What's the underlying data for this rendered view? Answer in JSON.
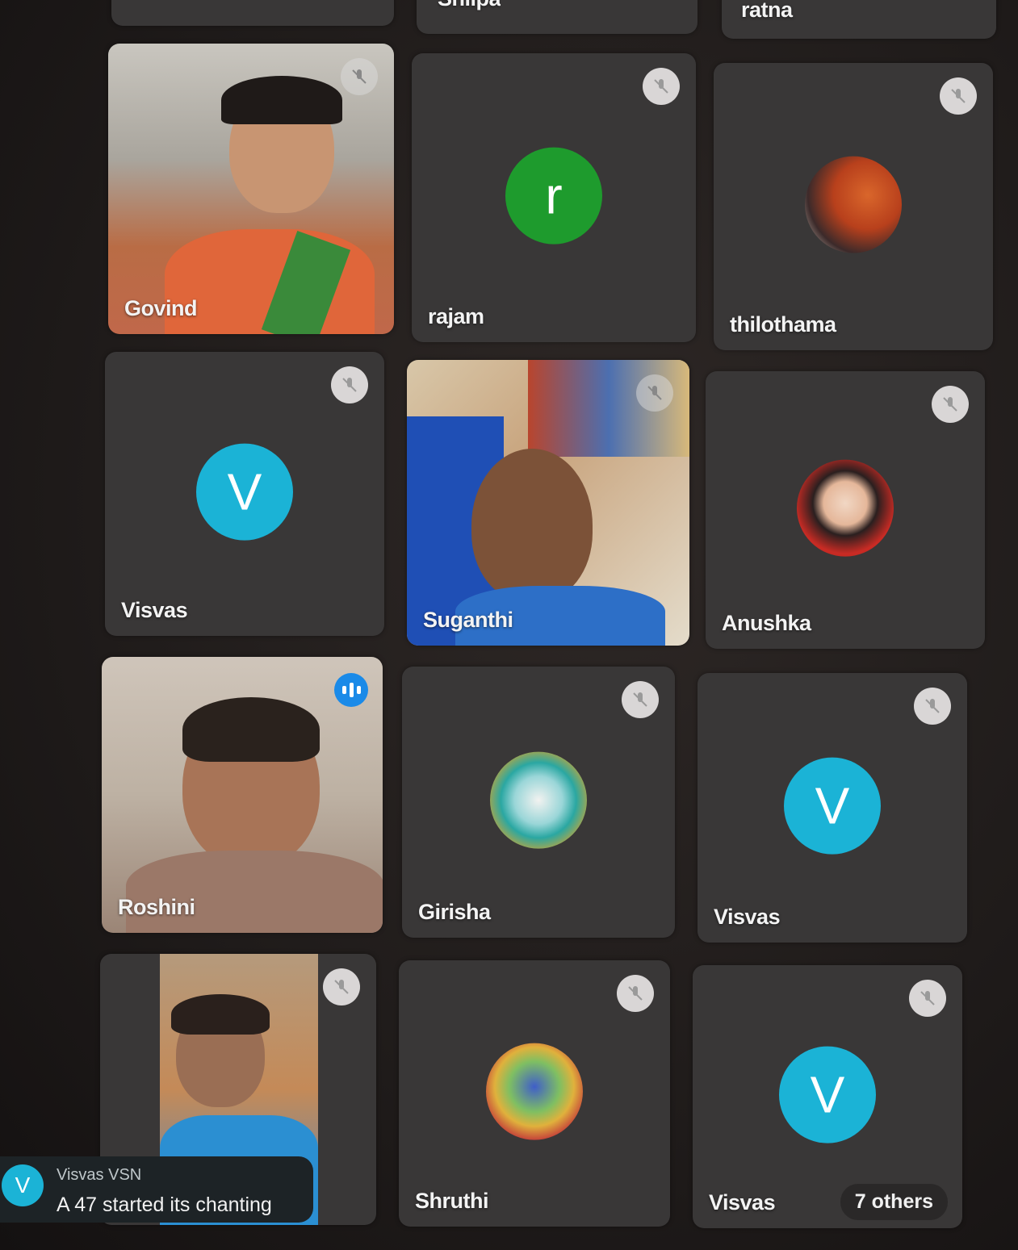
{
  "participants": {
    "top_shilpa": "Shilpa",
    "top_ratna": "ratna",
    "govind": "Govind",
    "rajam": "rajam",
    "rajam_initial": "r",
    "thilothama": "thilothama",
    "visvas1": "Visvas",
    "visvas1_initial": "V",
    "suganthi": "Suganthi",
    "anushka": "Anushka",
    "roshini": "Roshini",
    "girisha": "Girisha",
    "visvas2": "Visvas",
    "visvas2_initial": "V",
    "shruthi": "Shruthi",
    "visvas3": "Visvas",
    "visvas3_initial": "V"
  },
  "others_label": "7 others",
  "notification": {
    "avatar_initial": "V",
    "sender": "Visvas VSN",
    "message": "A 47 started its chanting"
  },
  "colors": {
    "tile_bg": "#393737",
    "avatar_blue": "#1bb3d6",
    "avatar_green": "#1e9b2d",
    "speaking_blue": "#1a8ae8"
  },
  "icons": [
    "mic-off-icon",
    "speaking-indicator-icon"
  ]
}
